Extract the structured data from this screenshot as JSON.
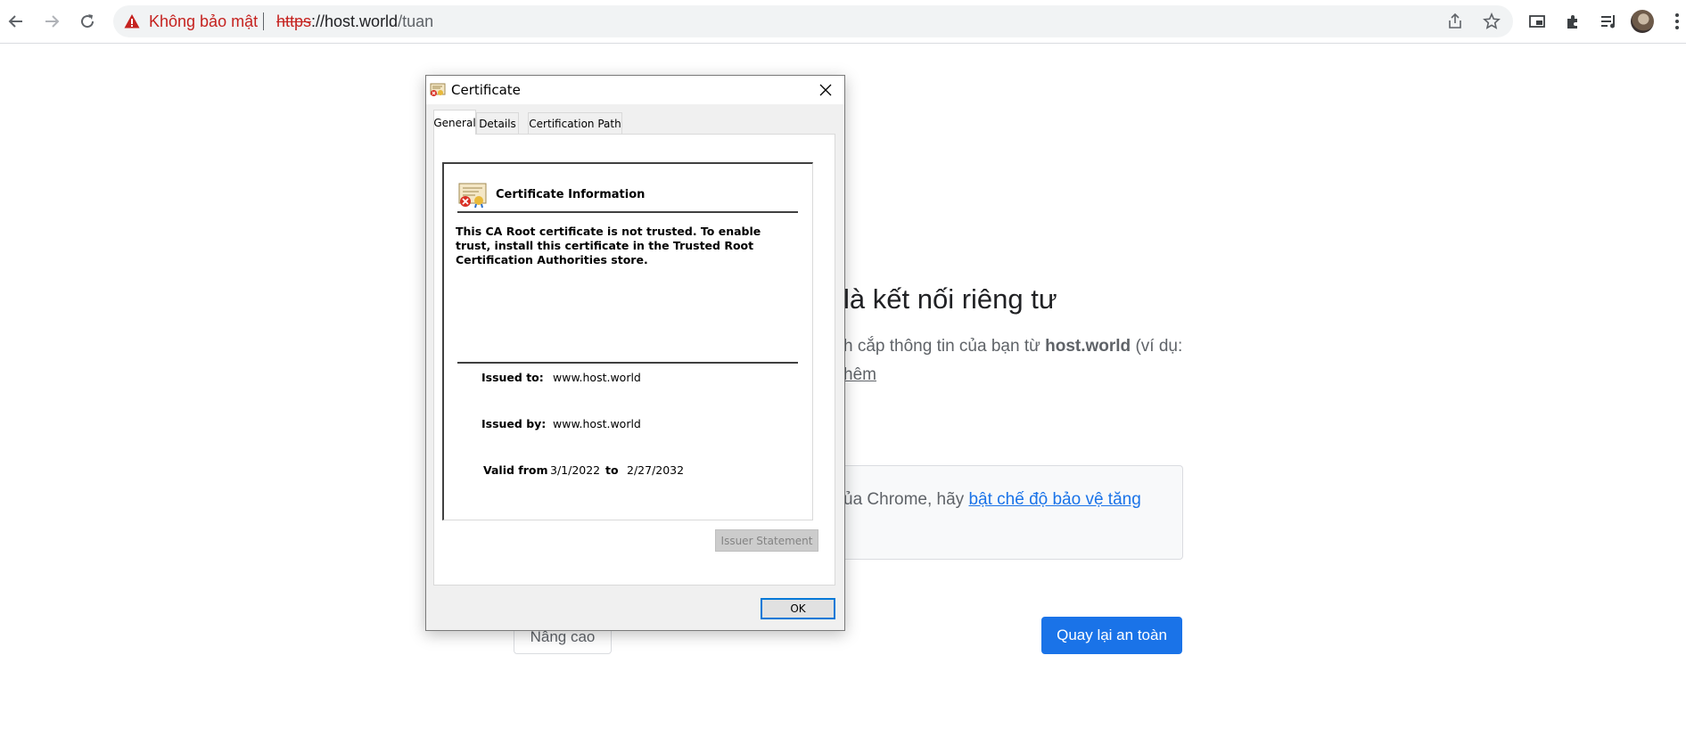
{
  "browser": {
    "security_chip": "Không bảo mật",
    "url_scheme": "https",
    "url_host": "://host.world",
    "url_path": "/tuan"
  },
  "page": {
    "heading": "là kết nối riêng tư",
    "text_before": "h cắp thông tin của bạn từ ",
    "text_host": "host.world",
    "text_after": " (ví dụ:",
    "learn_more": "hêm",
    "sb_text_before": "ủa Chrome, hãy ",
    "sb_link": "bật chế độ bảo vệ tăng",
    "advanced_label": "Nâng cao",
    "back_label": "Quay lại an toàn"
  },
  "dialog": {
    "title": "Certificate",
    "tabs": [
      "General",
      "Details",
      "Certification Path"
    ],
    "info_heading": "Certificate Information",
    "info_message": "This CA Root certificate is not trusted. To enable trust, install this certificate in the Trusted Root Certification Authorities store.",
    "issued_to_label": "Issued to:",
    "issued_to_value": "www.host.world",
    "issued_by_label": "Issued by:",
    "issued_by_value": "www.host.world",
    "valid_from_label": "Valid from",
    "valid_from_value": "3/1/2022",
    "valid_to_label": "to",
    "valid_to_value": "2/27/2032",
    "issuer_statement_label": "Issuer Statement",
    "ok_label": "OK"
  },
  "colors": {
    "warning_red": "#c5221f",
    "chrome_blue": "#1a73e8",
    "dialog_focus": "#0078d7"
  },
  "icons": [
    "back-arrow-icon",
    "forward-arrow-icon",
    "reload-icon",
    "warning-triangle-icon",
    "share-icon",
    "star-icon",
    "picture-in-picture-icon",
    "extensions-puzzle-icon",
    "reading-list-icon",
    "profile-avatar",
    "kebab-menu-icon",
    "certificate-icon",
    "close-icon"
  ]
}
